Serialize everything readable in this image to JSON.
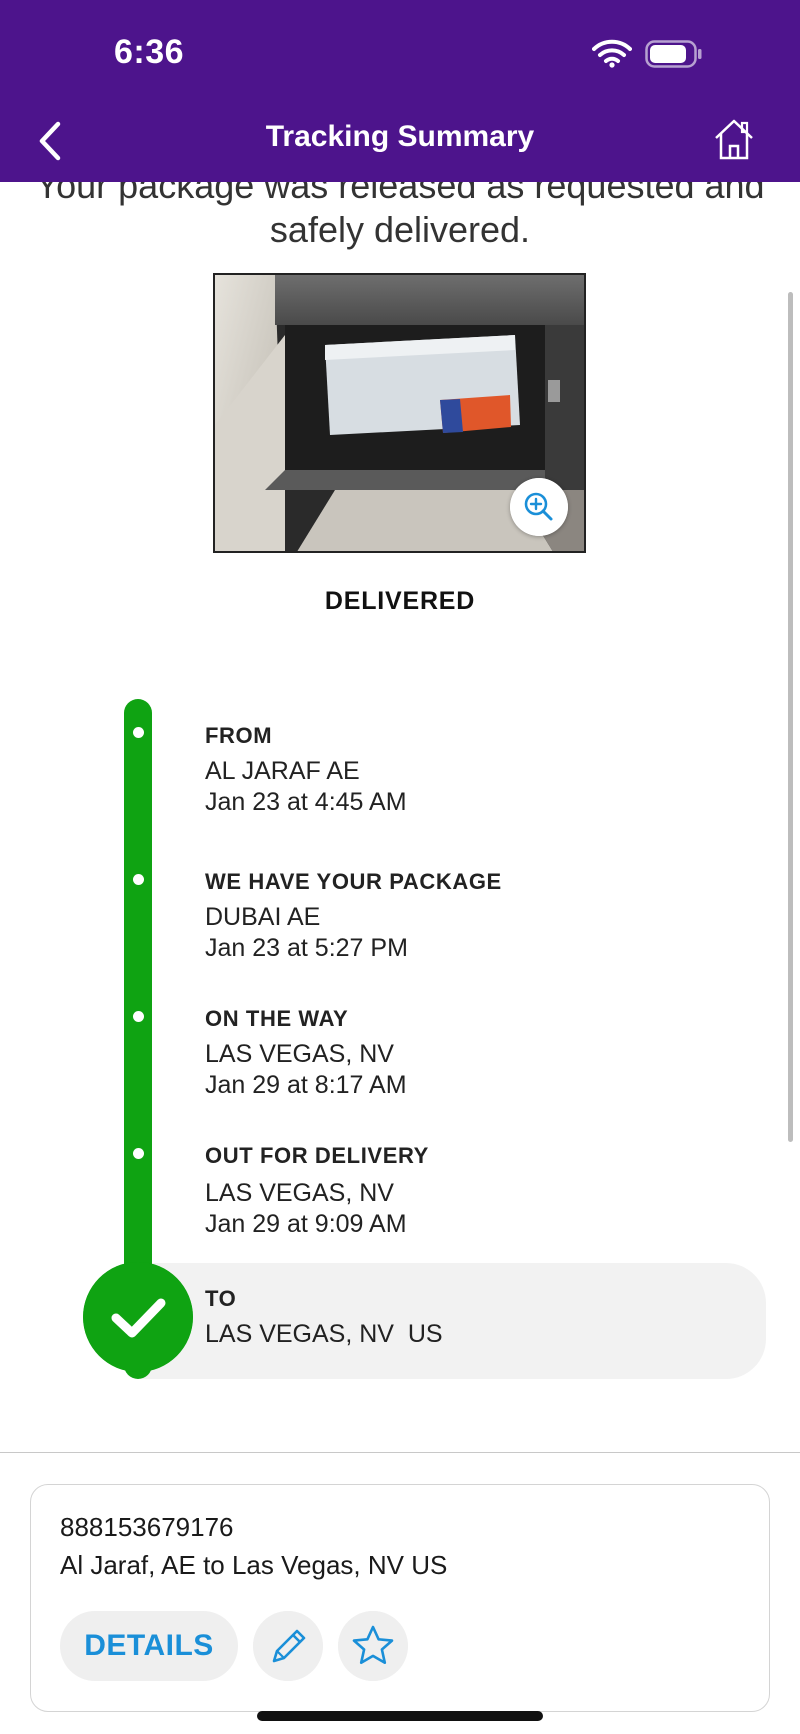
{
  "status_bar": {
    "time": "6:36"
  },
  "nav": {
    "title": "Tracking Summary",
    "back_icon": "chevron-left-icon",
    "home_icon": "home-icon"
  },
  "message": "Your package was released as requested and safely delivered.",
  "photo": {
    "zoom_icon": "zoom-in-icon"
  },
  "status": "DELIVERED",
  "timeline": [
    {
      "title": "FROM",
      "location": "AL JARAF AE",
      "time": "Jan 23 at 4:45 AM"
    },
    {
      "title": "WE HAVE YOUR PACKAGE",
      "location": "DUBAI AE",
      "time": "Jan 23 at 5:27 PM"
    },
    {
      "title": "ON THE WAY",
      "location": "LAS VEGAS, NV",
      "time": "Jan 29 at 8:17 AM"
    },
    {
      "title": "OUT FOR DELIVERY",
      "location": "LAS VEGAS, NV",
      "time": "Jan 29 at 9:09 AM"
    },
    {
      "title": "TO",
      "location": "LAS VEGAS, NV  US"
    }
  ],
  "card": {
    "tracking_number": "888153679176",
    "route": "Al Jaraf, AE to Las Vegas, NV US",
    "details_label": "DETAILS",
    "edit_icon": "pencil-icon",
    "favorite_icon": "star-icon"
  },
  "colors": {
    "header": "#4d148c",
    "progress": "#0fa312",
    "link": "#1a8fd8"
  }
}
